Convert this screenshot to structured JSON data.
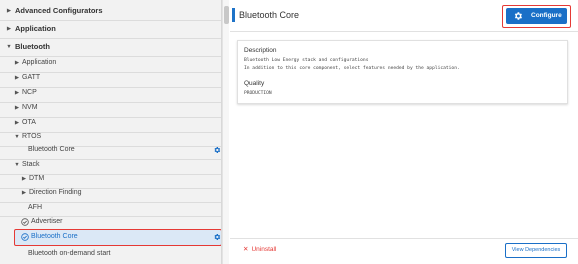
{
  "tree": {
    "items": [
      {
        "label": "Advanced Configurators",
        "level": "top",
        "state": "collapsed"
      },
      {
        "label": "Application",
        "level": "top",
        "state": "collapsed"
      },
      {
        "label": "Bluetooth",
        "level": "top",
        "state": "expanded"
      },
      {
        "label": "Application",
        "level": "child",
        "state": "collapsed"
      },
      {
        "label": "GATT",
        "level": "child",
        "state": "collapsed"
      },
      {
        "label": "NCP",
        "level": "child",
        "state": "collapsed"
      },
      {
        "label": "NVM",
        "level": "child",
        "state": "collapsed"
      },
      {
        "label": "OTA",
        "level": "child",
        "state": "collapsed"
      },
      {
        "label": "RTOS",
        "level": "child",
        "state": "expanded"
      },
      {
        "label": "Bluetooth Core",
        "level": "leaf",
        "icon": "gear-icon"
      },
      {
        "label": "Stack",
        "level": "child",
        "state": "expanded"
      },
      {
        "label": "DTM",
        "level": "child",
        "state": "collapsed"
      },
      {
        "label": "Direction Finding",
        "level": "child",
        "state": "collapsed"
      },
      {
        "label": "AFH",
        "level": "leaf"
      },
      {
        "label": "Advertiser",
        "level": "installed"
      },
      {
        "label": "Bluetooth Core",
        "level": "installed",
        "selected": true,
        "icon": "gear-icon"
      },
      {
        "label": "Bluetooth on-demand start",
        "level": "leaf"
      }
    ]
  },
  "detail": {
    "title": "Bluetooth Core",
    "configure_label": "Configure",
    "description_heading": "Description",
    "description_lines": [
      "Bluetooth Low Energy stack and configurations",
      "In addition to this core component, select features needed by the application."
    ],
    "quality_heading": "Quality",
    "quality_value": "PRODUCTION",
    "uninstall_label": "Uninstall",
    "view_dependencies_label": "View Dependencies"
  },
  "colors": {
    "accent": "#1a6fc7",
    "danger": "#e53935",
    "selected_bg": "#dbe8f6",
    "panel_bg": "#f2f2f2"
  }
}
